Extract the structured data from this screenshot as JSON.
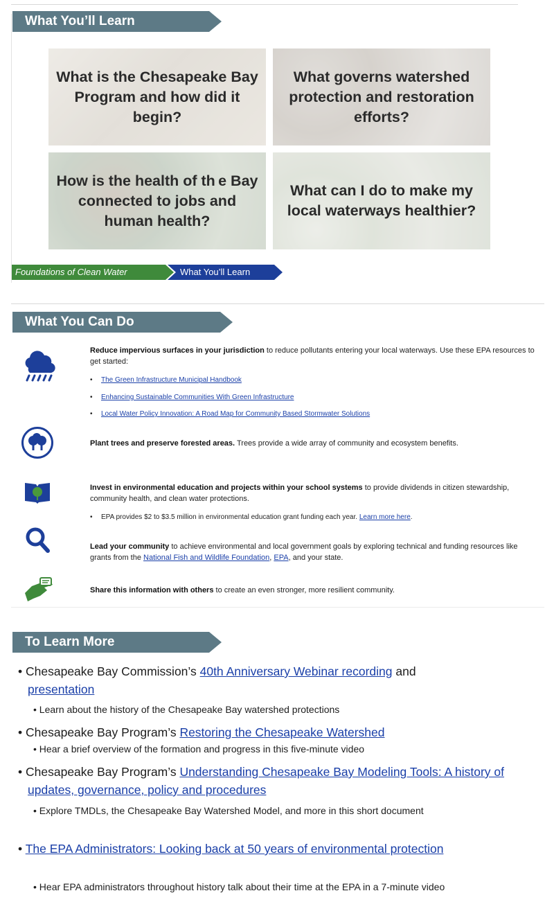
{
  "learn": {
    "banner": "What You’ll Learn",
    "tiles": [
      "What is the Chesapeake Bay Program and how did it begin?",
      "What governs watershed protection and restoration efforts?",
      "How is the health of th e Bay connected to jobs and human health?",
      "What can I do to make my local waterways healthier?"
    ],
    "breadcrumb": [
      "Foundations of Clean Water",
      "What You’ll Learn"
    ]
  },
  "do": {
    "banner": "What You Can Do",
    "items": [
      {
        "bold": "Reduce impervious surfaces in your jurisdiction",
        "text": " to reduce pollutants entering your local waterways. Use these EPA resources to get started:",
        "links": [
          "The Green Infrastructure Municipal Handbook",
          "Enhancing  Sustainable Communities With Green Infrastructure",
          "Local Water Policy Innovation: A Road Map for Community Based Stormwater Solutions"
        ]
      },
      {
        "bold": "Plant trees and preserve forested areas.",
        "text": " Trees provide a wide array of community and ecosystem benefits."
      },
      {
        "bold": "Invest in environmental education and projects within your school systems",
        "text": " to provide dividends in citizen stewardship, community health, and clean water protections.",
        "sub_text": "EPA provides $2 to $3.5 million in environmental education grant funding each year. ",
        "sub_link": "Learn more here",
        "sub_end": "."
      },
      {
        "bold": "Lead your community",
        "text": " to achieve environmental and local government goals by exploring technical and funding resources like grants from the ",
        "link1": "National Fish and Wildlife Foundation",
        "sep": ", ",
        "link2": "EPA",
        "end": ", and your state."
      },
      {
        "bold": "Share this information with others",
        "text": " to create an even stronger, more resilient community."
      }
    ]
  },
  "more": {
    "banner": "To Learn More",
    "items": [
      {
        "pre": "Chesapeake Bay Commission’s ",
        "link": "40th Anniversary Webinar recording",
        "mid": " and ",
        "link2": "presentation",
        "sub": "Learn about the history of the Chesapeake Bay watershed protections"
      },
      {
        "pre": "Chesapeake Bay Program’s ",
        "link": "Restoring the Chesapeake Watershed",
        "sub": "Hear a brief overview of the formation and progress in this five-minute video"
      },
      {
        "pre": "Chesapeake Bay Program’s ",
        "link": "Understanding Chesapeake Bay Modeling Tools: A history of updates, governance, policy and procedures",
        "sub": "Explore TMDLs, the Chesapeake Bay Watershed Model, and more in this short document"
      },
      {
        "link": "The EPA Administrators: Looking back at 50 years of environmental protection",
        "sub": "Hear EPA administrators throughout history talk about their time at the EPA in a 7-minute video"
      }
    ]
  }
}
